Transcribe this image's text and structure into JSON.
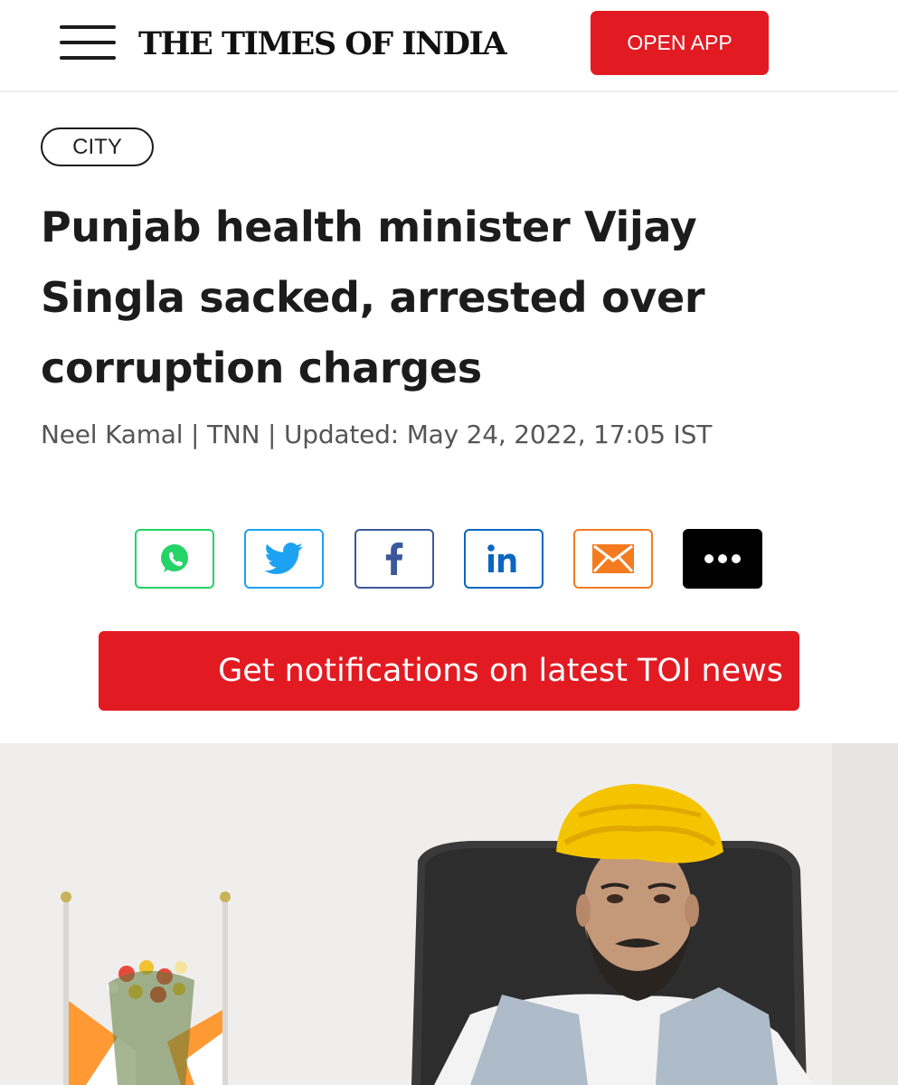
{
  "header": {
    "masthead": "THE TIMES OF INDIA",
    "open_app_label": "OPEN APP"
  },
  "article": {
    "category": "CITY",
    "headline": "Punjab health minister Vijay Singla sacked, arrested over corruption charges",
    "byline": "Neel Kamal | TNN | Updated: May 24, 2022, 17:05 IST"
  },
  "share": {
    "icons": [
      "whatsapp-icon",
      "twitter-icon",
      "facebook-icon",
      "linkedin-icon",
      "email-icon",
      "more-icon"
    ]
  },
  "notifications": {
    "label": "Get notifications on latest TOI news"
  },
  "colors": {
    "brand_red": "#e21b23",
    "whatsapp": "#25d366",
    "twitter": "#1da1f2",
    "facebook": "#3b5998",
    "linkedin": "#0a66c2",
    "email": "#f47b20"
  }
}
